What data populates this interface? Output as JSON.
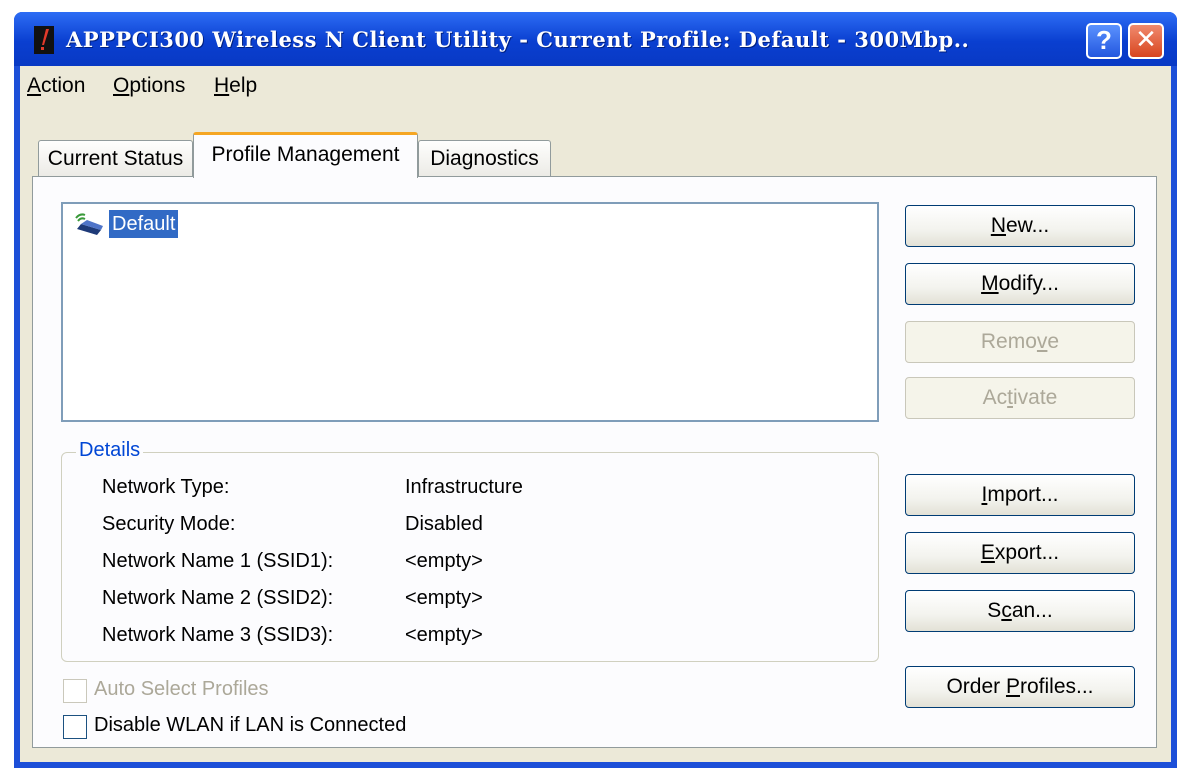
{
  "window": {
    "title": "APPPCI300 Wireless N Client Utility - Current Profile: Default - 300Mbp..",
    "help_glyph": "?",
    "close_glyph": "✕"
  },
  "menu": [
    {
      "accel": "A",
      "rest": "ction"
    },
    {
      "accel": "O",
      "rest": "ptions"
    },
    {
      "accel": "H",
      "rest": "elp"
    }
  ],
  "tabs": [
    "Current Status",
    "Profile Management",
    "Diagnostics"
  ],
  "active_tab": "Profile Management",
  "profiles": [
    {
      "name": "Default",
      "icon": "wireless-laptop-icon",
      "selected": true
    }
  ],
  "buttons": {
    "new": {
      "pre": "",
      "accel": "N",
      "post": "ew...",
      "enabled": true
    },
    "modify": {
      "pre": "",
      "accel": "M",
      "post": "odify...",
      "enabled": true
    },
    "remove": {
      "pre": "Remo",
      "accel": "v",
      "post": "e",
      "enabled": false
    },
    "activate": {
      "pre": "Ac",
      "accel": "t",
      "post": "ivate",
      "enabled": false
    },
    "import": {
      "pre": "",
      "accel": "I",
      "post": "mport...",
      "enabled": true
    },
    "export": {
      "pre": "",
      "accel": "E",
      "post": "xport...",
      "enabled": true
    },
    "scan": {
      "pre": "S",
      "accel": "c",
      "post": "an...",
      "enabled": true
    },
    "order_profiles": {
      "pre": "Order ",
      "accel": "P",
      "post": "rofiles...",
      "enabled": true
    }
  },
  "details": {
    "legend": "Details",
    "rows": [
      {
        "label": "Network Type:",
        "value": "Infrastructure"
      },
      {
        "label": "Security Mode:",
        "value": "Disabled"
      },
      {
        "label": "Network Name 1 (SSID1):",
        "value": "<empty>"
      },
      {
        "label": "Network Name 2 (SSID2):",
        "value": "<empty>"
      },
      {
        "label": "Network Name 3 (SSID3):",
        "value": "<empty>"
      }
    ]
  },
  "checkboxes": {
    "auto_select": {
      "label": "Auto Select Profiles",
      "checked": false,
      "enabled": false
    },
    "disable_wlan": {
      "label": "Disable WLAN if LAN is Connected",
      "checked": false,
      "enabled": true
    }
  },
  "colors": {
    "titlebar": "#0a3fd0",
    "selection": "#316ac5",
    "active_tab_accent": "#f5a623",
    "details_legend": "#0046d5",
    "disabled_text": "#aca899"
  }
}
